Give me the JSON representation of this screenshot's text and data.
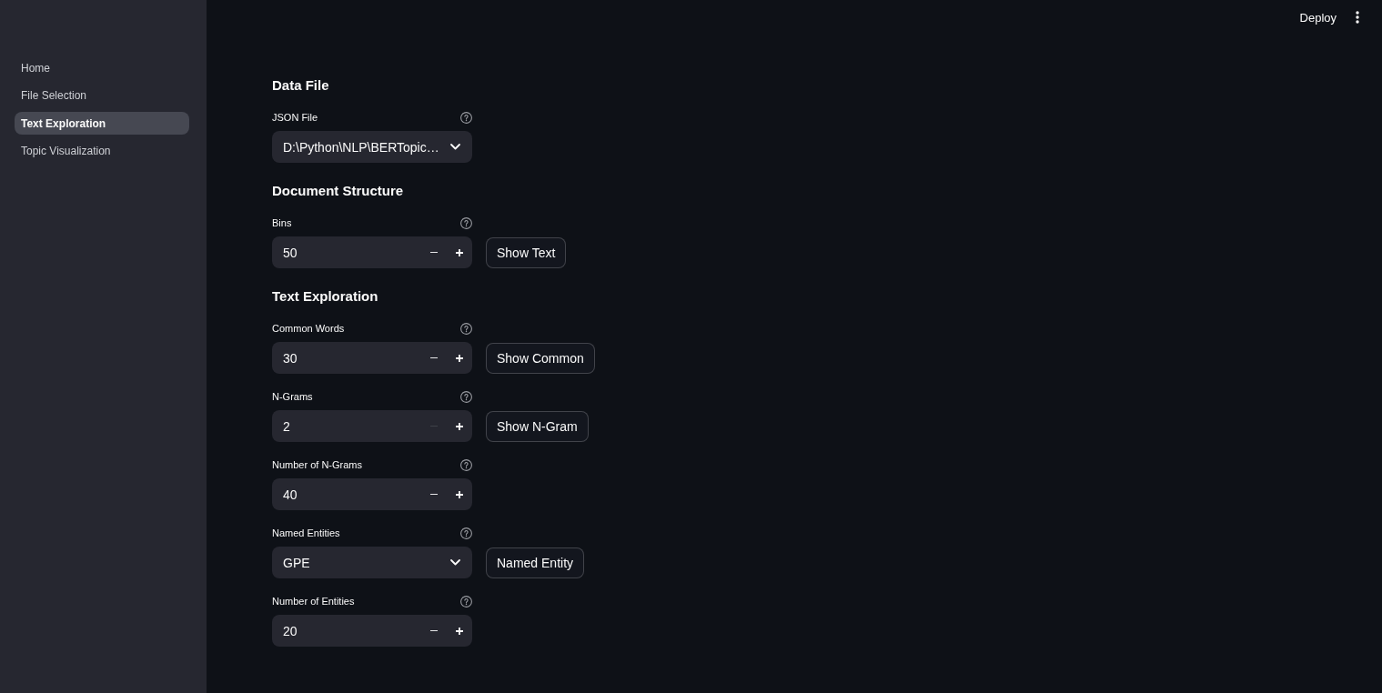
{
  "header": {
    "deploy_button": "Deploy"
  },
  "sidebar": {
    "items": [
      {
        "label": "Home",
        "selected": false
      },
      {
        "label": "File Selection",
        "selected": false
      },
      {
        "label": "Text Exploration",
        "selected": true
      },
      {
        "label": "Topic Visualization",
        "selected": false
      }
    ]
  },
  "sections": [
    {
      "title": "Data File",
      "widgets": [
        {
          "kind": "select",
          "label": "JSON File",
          "value": "D:\\Python\\NLP\\BERTopic…"
        }
      ]
    },
    {
      "title": "Document Structure",
      "widgets": [
        {
          "kind": "number",
          "label": "Bins",
          "value": "50",
          "minus_disabled": false,
          "button": "Show Text"
        }
      ]
    },
    {
      "title": "Text Exploration",
      "widgets": [
        {
          "kind": "number",
          "label": "Common Words",
          "value": "30",
          "minus_disabled": false,
          "button": "Show Common"
        },
        {
          "kind": "number",
          "label": "N-Grams",
          "value": "2",
          "minus_disabled": true,
          "button": "Show N-Gram"
        },
        {
          "kind": "number",
          "label": "Number of N-Grams",
          "value": "40",
          "minus_disabled": false
        },
        {
          "kind": "select",
          "label": "Named Entities",
          "value": "GPE",
          "button": "Named Entity"
        },
        {
          "kind": "number",
          "label": "Number of Entities",
          "value": "20",
          "minus_disabled": false
        }
      ]
    }
  ]
}
